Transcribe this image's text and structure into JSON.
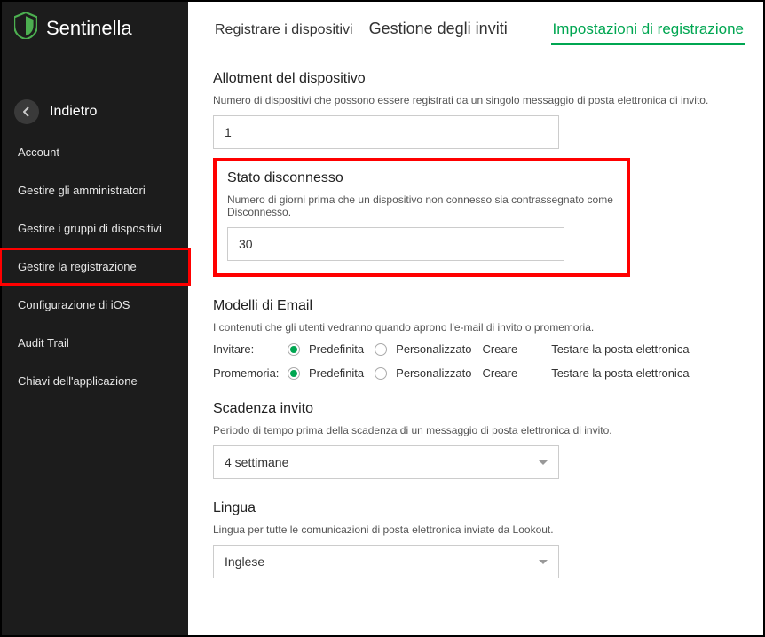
{
  "brand": {
    "name": "Sentinella"
  },
  "backLabel": "Indietro",
  "sidebar": {
    "items": [
      {
        "label": "Account"
      },
      {
        "label": "Gestire gli amministratori"
      },
      {
        "label": "Gestire i gruppi di dispositivi"
      },
      {
        "label": "Gestire la registrazione"
      },
      {
        "label": "Configurazione di iOS"
      },
      {
        "label": "Audit Trail"
      },
      {
        "label": "Chiavi dell'applicazione"
      }
    ]
  },
  "tabs": [
    {
      "label": "Registrare i dispositivi"
    },
    {
      "label": "Gestione degli inviti"
    },
    {
      "label": "Impostazioni di registrazione"
    }
  ],
  "allotment": {
    "title": "Allotment del dispositivo",
    "desc": "Numero di dispositivi che possono essere registrati da un singolo messaggio di posta elettronica di invito.",
    "value": "1"
  },
  "disconnected": {
    "title": "Stato disconnesso",
    "desc": "Numero di giorni prima che un dispositivo non connesso sia contrassegnato come Disconnesso.",
    "value": "30"
  },
  "emailModels": {
    "title": "Modelli di Email",
    "desc": "I contenuti che gli utenti vedranno quando aprono l'e-mail di invito o promemoria.",
    "inviteLabel": "Invitare:",
    "reminderLabel": "Promemoria:",
    "defaultOpt": "Predefinita",
    "customOpt": "Personalizzato",
    "createLink": "Creare",
    "testLink": "Testare la posta elettronica"
  },
  "expiry": {
    "title": "Scadenza invito",
    "desc": "Periodo di tempo prima della scadenza di un messaggio di posta elettronica di invito.",
    "value": "4 settimane"
  },
  "language": {
    "title": "Lingua",
    "desc": "Lingua per tutte le comunicazioni di posta elettronica inviate da Lookout.",
    "value": "Inglese"
  }
}
